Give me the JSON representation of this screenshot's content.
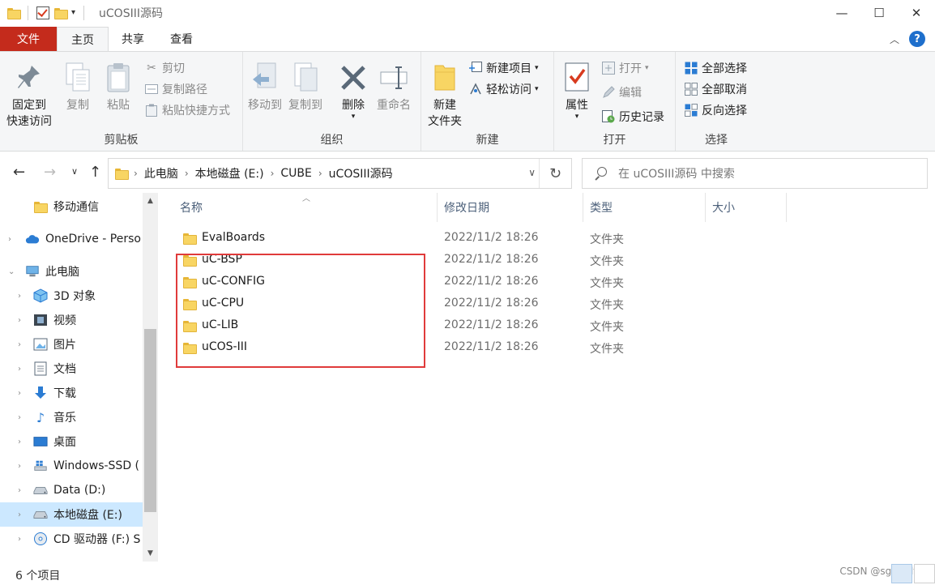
{
  "window": {
    "title": "uCOSIII源码",
    "minimize": "—",
    "maximize": "☐",
    "close": "✕"
  },
  "tabs": [
    {
      "label": "文件"
    },
    {
      "label": "主页"
    },
    {
      "label": "共享"
    },
    {
      "label": "查看"
    }
  ],
  "ribbon": {
    "clipboard": {
      "name": "剪贴板",
      "pin_l1": "固定到",
      "pin_l2": "快速访问",
      "copy": "复制",
      "paste": "粘贴",
      "cut": "剪切",
      "copy_path": "复制路径",
      "paste_shortcut": "粘贴快捷方式"
    },
    "organize": {
      "name": "组织",
      "move_to": "移动到",
      "copy_to": "复制到",
      "delete": "删除",
      "rename": "重命名"
    },
    "new": {
      "name": "新建",
      "folder_l1": "新建",
      "folder_l2": "文件夹",
      "new_item": "新建项目",
      "easy_access": "轻松访问"
    },
    "open": {
      "name": "打开",
      "properties": "属性",
      "open": "打开",
      "edit": "编辑",
      "history": "历史记录"
    },
    "select": {
      "name": "选择",
      "select_all": "全部选择",
      "select_none": "全部取消",
      "invert": "反向选择"
    }
  },
  "address": {
    "crumbs": [
      "此电脑",
      "本地磁盘 (E:)",
      "CUBE",
      "uCOSIII源码"
    ],
    "search_placeholder": "在 uCOSIII源码 中搜索"
  },
  "nav": [
    {
      "label": "移动通信"
    },
    {
      "label": "OneDrive - Perso"
    },
    {
      "label": "此电脑"
    },
    {
      "label": "3D 对象"
    },
    {
      "label": "视频"
    },
    {
      "label": "图片"
    },
    {
      "label": "文档"
    },
    {
      "label": "下载"
    },
    {
      "label": "音乐"
    },
    {
      "label": "桌面"
    },
    {
      "label": "Windows-SSD ("
    },
    {
      "label": "Data (D:)"
    },
    {
      "label": "本地磁盘 (E:)"
    },
    {
      "label": "CD 驱动器 (F:) S"
    }
  ],
  "columns": {
    "name": "名称",
    "date": "修改日期",
    "type": "类型",
    "size": "大小"
  },
  "files": [
    {
      "name": "EvalBoards",
      "date": "2022/11/2 18:26",
      "type": "文件夹"
    },
    {
      "name": "uC-BSP",
      "date": "2022/11/2 18:26",
      "type": "文件夹"
    },
    {
      "name": "uC-CONFIG",
      "date": "2022/11/2 18:26",
      "type": "文件夹"
    },
    {
      "name": "uC-CPU",
      "date": "2022/11/2 18:26",
      "type": "文件夹"
    },
    {
      "name": "uC-LIB",
      "date": "2022/11/2 18:26",
      "type": "文件夹"
    },
    {
      "name": "uCOS-III",
      "date": "2022/11/2 18:26",
      "type": "文件夹"
    }
  ],
  "status": {
    "count": "6 个项目",
    "watermark": "CSDN @sgpdfdt"
  },
  "colors": {
    "file_tab": "#c42b1c",
    "selection": "#cce8ff",
    "highlight_box": "#e03b3b",
    "folder": "#f8d563"
  }
}
